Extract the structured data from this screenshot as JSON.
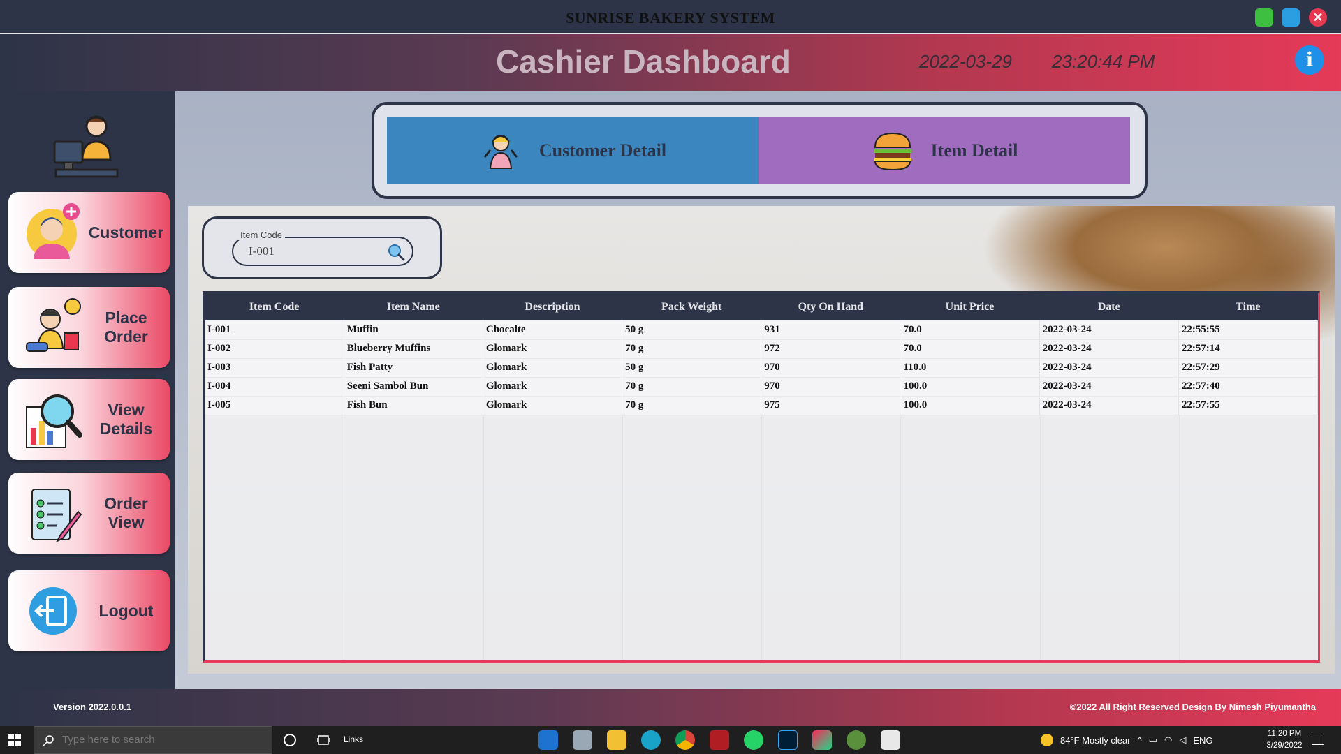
{
  "window": {
    "title": "SUNRISE BAKERY SYSTEM",
    "close_glyph": "✕"
  },
  "header": {
    "title": "Cashier Dashboard",
    "date": "2022-03-29",
    "time": "23:20:44 PM",
    "info_glyph": "i"
  },
  "sidebar": {
    "items": [
      {
        "label": "Customer",
        "icon": "add-customer-icon"
      },
      {
        "label": "Place Order",
        "icon": "place-order-icon"
      },
      {
        "label": "View Details",
        "icon": "view-details-icon"
      },
      {
        "label": "Order View",
        "icon": "order-view-icon"
      },
      {
        "label": "Logout",
        "icon": "logout-icon"
      }
    ]
  },
  "tabs": {
    "customer_label": "Customer Detail",
    "item_label": "Item Detail"
  },
  "search": {
    "label": "Item Code",
    "value": "I-001"
  },
  "table": {
    "headers": [
      "Item Code",
      "Item Name",
      "Description",
      "Pack Weight",
      "Qty On Hand",
      "Unit Price",
      "Date",
      "Time"
    ],
    "rows": [
      [
        "I-001",
        "Muffin",
        "Chocalte",
        "50 g",
        "931",
        "70.0",
        "2022-03-24",
        "22:55:55"
      ],
      [
        "I-002",
        "Blueberry Muffins",
        "Glomark",
        "70 g",
        "972",
        "70.0",
        "2022-03-24",
        "22:57:14"
      ],
      [
        "I-003",
        "Fish Patty",
        "Glomark",
        "50 g",
        "970",
        "110.0",
        "2022-03-24",
        "22:57:29"
      ],
      [
        "I-004",
        "Seeni Sambol Bun",
        "Glomark",
        "70 g",
        "970",
        "100.0",
        "2022-03-24",
        "22:57:40"
      ],
      [
        "I-005",
        "Fish Bun",
        "Glomark",
        "70 g",
        "975",
        "100.0",
        "2022-03-24",
        "22:57:55"
      ]
    ]
  },
  "footer": {
    "version": "Version 2022.0.0.1",
    "copyright": "©2022  All Right Reserved Design By Nimesh Piyumantha"
  },
  "taskbar": {
    "search_placeholder": "Type here to search",
    "links_label": "Links",
    "weather": "84°F  Mostly clear",
    "language": "ENG",
    "clock_time": "11:20 PM",
    "clock_date": "3/29/2022"
  },
  "colors": {
    "dark": "#2d3447",
    "accent_red": "#e53a58",
    "customer_tab": "#3b86bf",
    "item_tab": "#a06cbf",
    "info_blue": "#1e90e8"
  }
}
